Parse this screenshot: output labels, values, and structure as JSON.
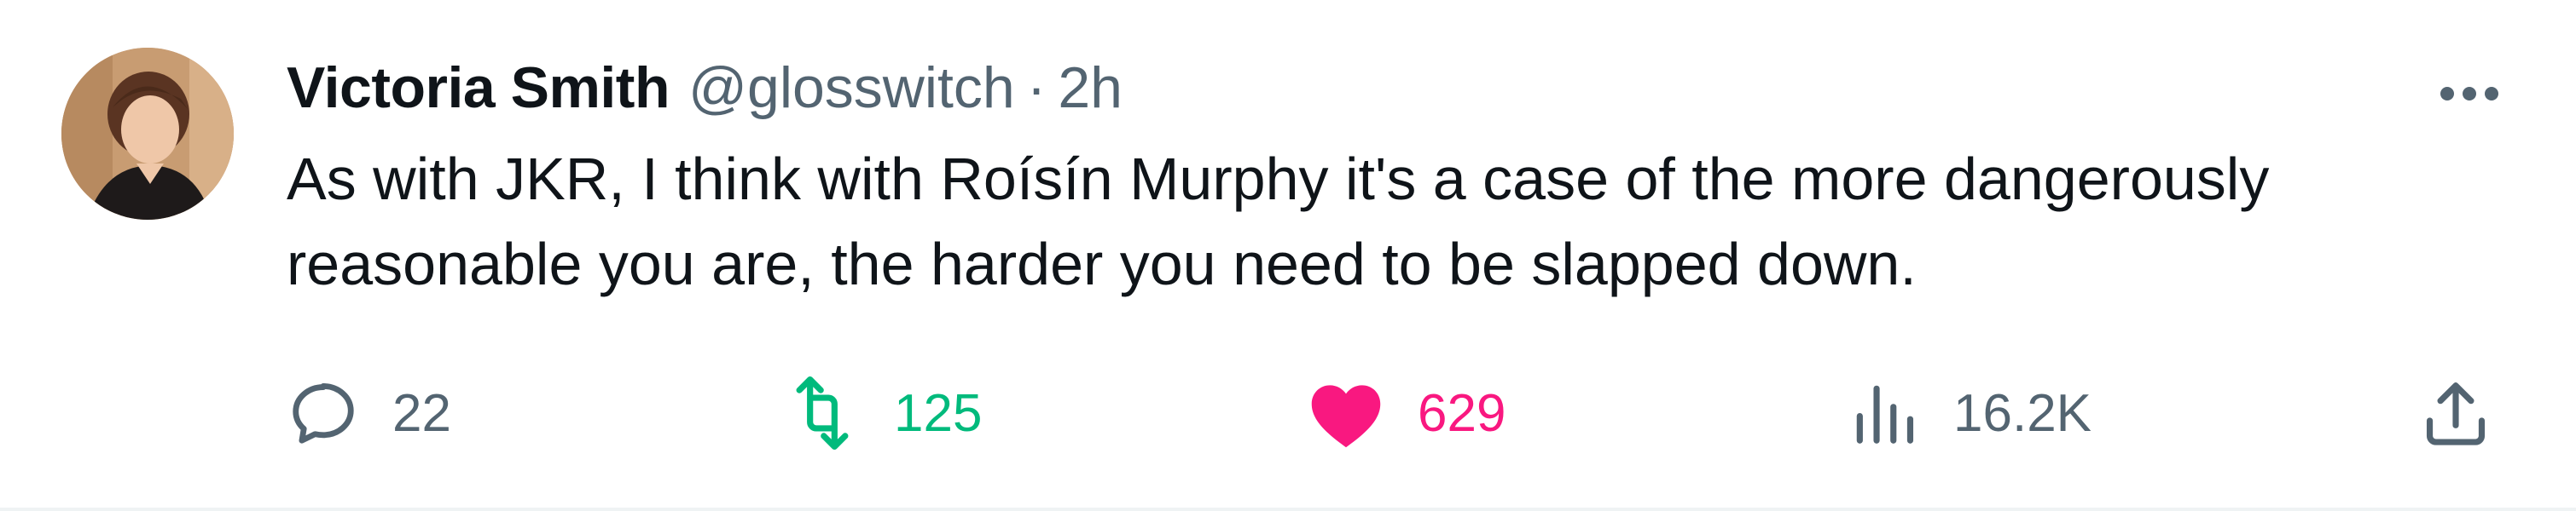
{
  "tweet": {
    "author": {
      "display_name": "Victoria Smith",
      "handle": "@glosswitch",
      "avatar_icon": "profile-photo"
    },
    "separator": "·",
    "timestamp": "2h",
    "text_lines": [
      "As with JKR, I think with Roísín Murphy it's a case of the more dangerously",
      "reasonable you are, the harder you need to be slapped down."
    ],
    "more_icon": "ellipsis-icon",
    "actions": {
      "reply": {
        "icon": "speech-bubble-icon",
        "count": "22"
      },
      "retweet": {
        "icon": "retweet-arrows-icon",
        "count": "125",
        "color": "#00ba7c"
      },
      "like": {
        "icon": "heart-filled-icon",
        "count": "629",
        "color": "#f91880"
      },
      "views": {
        "icon": "bar-chart-icon",
        "count": "16.2K"
      },
      "share": {
        "icon": "upload-arrow-icon"
      }
    }
  },
  "colors": {
    "text_primary": "#0f1419",
    "text_secondary": "#536471",
    "retweet_green": "#00ba7c",
    "like_pink": "#f91880",
    "divider": "#eff3f4"
  }
}
